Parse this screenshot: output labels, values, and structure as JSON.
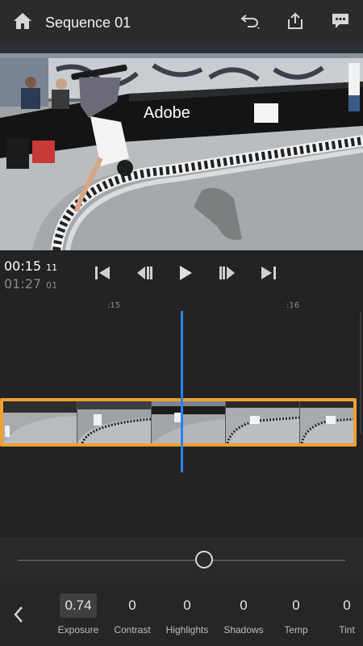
{
  "header": {
    "title": "Sequence 01",
    "icons": [
      "home-icon",
      "undo-icon",
      "share-icon",
      "comment-icon"
    ]
  },
  "preview": {
    "banner_text": "Adobe"
  },
  "transport": {
    "current_time": "00:15",
    "current_frame": "11",
    "duration_time": "01:27",
    "duration_frame": "01",
    "icons": [
      "skip-to-start-icon",
      "step-back-icon",
      "play-icon",
      "step-forward-icon",
      "skip-to-end-icon"
    ]
  },
  "timeline": {
    "ruler_labels": [
      ":15",
      ":16"
    ],
    "accent_color": "#f0a030",
    "playhead_color": "#2d7ff0"
  },
  "slider": {
    "value_fraction": 0.57
  },
  "adjustments": {
    "items": [
      {
        "label": "Exposure",
        "value": "0.74",
        "selected": true
      },
      {
        "label": "Contrast",
        "value": "0"
      },
      {
        "label": "Highlights",
        "value": "0"
      },
      {
        "label": "Shadows",
        "value": "0"
      },
      {
        "label": "Temp",
        "value": "0"
      },
      {
        "label": "Tint",
        "value": "0"
      }
    ]
  }
}
